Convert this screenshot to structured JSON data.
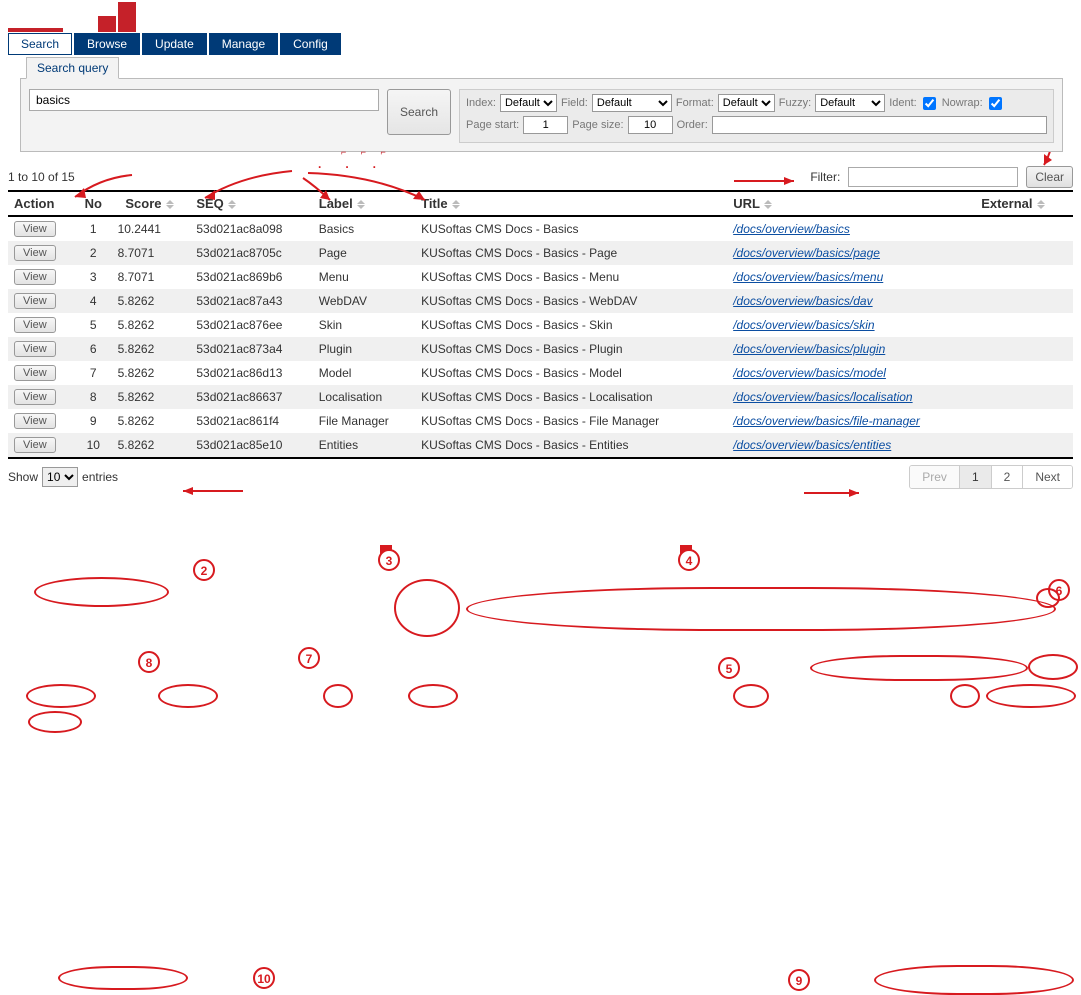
{
  "nav": {
    "tabs": [
      "Search",
      "Browse",
      "Update",
      "Manage",
      "Config"
    ],
    "active": 0
  },
  "panel": {
    "title": "Search query",
    "query_value": "basics",
    "search_btn": "Search",
    "opts": {
      "index_label": "Index:",
      "index_value": "Default",
      "field_label": "Field:",
      "field_value": "Default",
      "format_label": "Format:",
      "format_value": "Default",
      "fuzzy_label": "Fuzzy:",
      "fuzzy_value": "Default",
      "ident_label": "Ident:",
      "ident_checked": true,
      "nowrap_label": "Nowrap:",
      "nowrap_checked": true,
      "page_start_label": "Page start:",
      "page_start_value": "1",
      "page_size_label": "Page size:",
      "page_size_value": "10",
      "order_label": "Order:",
      "order_value": ""
    }
  },
  "results": {
    "count_text": "1 to 10 of 15",
    "filter_label": "Filter:",
    "filter_value": "",
    "clear_btn": "Clear",
    "columns": [
      "Action",
      "No",
      "Score",
      "SEQ",
      "Label",
      "Title",
      "URL",
      "External"
    ],
    "rows": [
      {
        "no": "1",
        "score": "10.2441",
        "seq": "53d021ac8a098",
        "label": "Basics",
        "title": "KUSoftas CMS Docs - Basics",
        "url": "/docs/overview/basics"
      },
      {
        "no": "2",
        "score": "8.7071",
        "seq": "53d021ac8705c",
        "label": "Page",
        "title": "KUSoftas CMS Docs - Basics - Page",
        "url": "/docs/overview/basics/page"
      },
      {
        "no": "3",
        "score": "8.7071",
        "seq": "53d021ac869b6",
        "label": "Menu",
        "title": "KUSoftas CMS Docs - Basics - Menu",
        "url": "/docs/overview/basics/menu"
      },
      {
        "no": "4",
        "score": "5.8262",
        "seq": "53d021ac87a43",
        "label": "WebDAV",
        "title": "KUSoftas CMS Docs - Basics - WebDAV",
        "url": "/docs/overview/basics/dav"
      },
      {
        "no": "5",
        "score": "5.8262",
        "seq": "53d021ac876ee",
        "label": "Skin",
        "title": "KUSoftas CMS Docs - Basics - Skin",
        "url": "/docs/overview/basics/skin"
      },
      {
        "no": "6",
        "score": "5.8262",
        "seq": "53d021ac873a4",
        "label": "Plugin",
        "title": "KUSoftas CMS Docs - Basics - Plugin",
        "url": "/docs/overview/basics/plugin"
      },
      {
        "no": "7",
        "score": "5.8262",
        "seq": "53d021ac86d13",
        "label": "Model",
        "title": "KUSoftas CMS Docs - Basics - Model",
        "url": "/docs/overview/basics/model"
      },
      {
        "no": "8",
        "score": "5.8262",
        "seq": "53d021ac86637",
        "label": "Localisation",
        "title": "KUSoftas CMS Docs - Basics - Localisation",
        "url": "/docs/overview/basics/localisation"
      },
      {
        "no": "9",
        "score": "5.8262",
        "seq": "53d021ac861f4",
        "label": "File Manager",
        "title": "KUSoftas CMS Docs - Basics - File Manager",
        "url": "/docs/overview/basics/file-manager"
      },
      {
        "no": "10",
        "score": "5.8262",
        "seq": "53d021ac85e10",
        "label": "Entities",
        "title": "KUSoftas CMS Docs - Basics - Entities",
        "url": "/docs/overview/basics/entities"
      }
    ],
    "view_label": "View"
  },
  "bottom": {
    "show_prefix": "Show",
    "show_value": "10",
    "show_suffix": "entries",
    "pager": {
      "prev": "Prev",
      "pages": [
        "1",
        "2"
      ],
      "next": "Next",
      "current": 0
    }
  },
  "annotations": {
    "2": "2",
    "3": "3",
    "4": "4",
    "5": "5",
    "6": "6",
    "7": "7",
    "8": "8",
    "9": "9",
    "10": "10"
  }
}
